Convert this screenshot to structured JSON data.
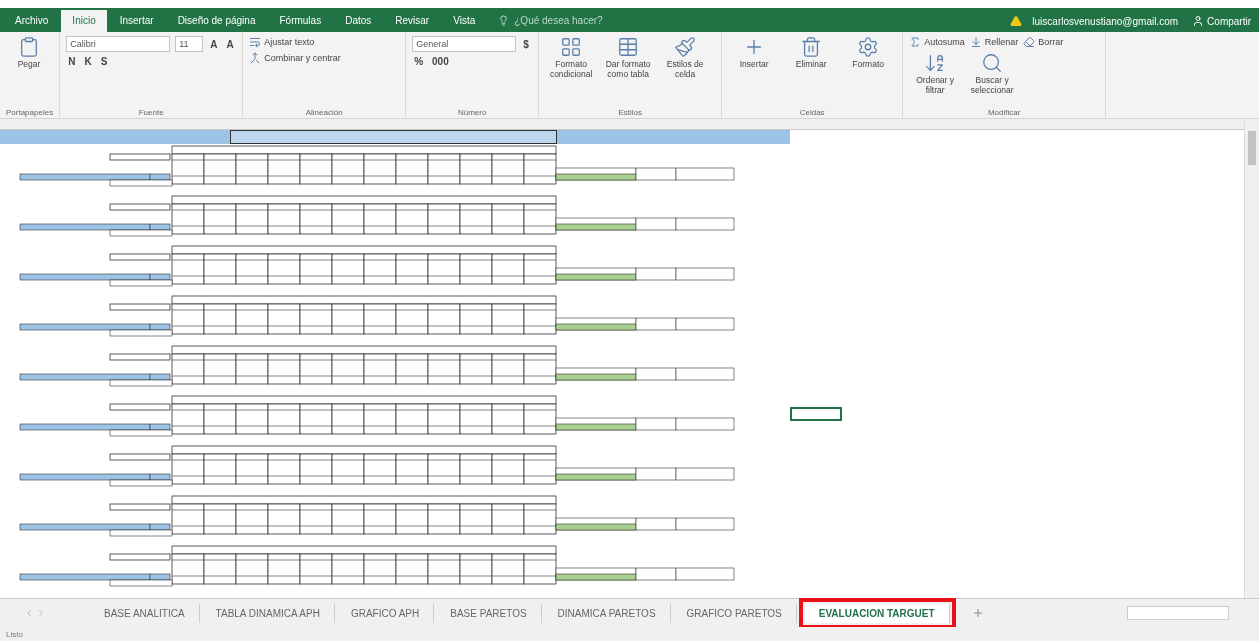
{
  "menu_tabs": [
    {
      "label": "Archivo",
      "selected": false
    },
    {
      "label": "Inicio",
      "selected": true
    },
    {
      "label": "Insertar",
      "selected": false
    },
    {
      "label": "Diseño de página",
      "selected": false
    },
    {
      "label": "Fórmulas",
      "selected": false
    },
    {
      "label": "Datos",
      "selected": false
    },
    {
      "label": "Revisar",
      "selected": false
    },
    {
      "label": "Vista",
      "selected": false
    }
  ],
  "tell_me": {
    "placeholder": "¿Qué desea hacer?"
  },
  "account": "luiscarlosvenustiano@gmail.com",
  "share": "Compartir",
  "ribbon": {
    "groups": [
      {
        "label": "Portapapeles",
        "items": [
          {
            "kind": "large",
            "label": "Pegar"
          }
        ]
      },
      {
        "label": "Fuente",
        "items": [
          {
            "kind": "field",
            "value": "Calibri",
            "wide": true
          },
          {
            "kind": "field",
            "value": "11",
            "wide": false
          },
          {
            "kind": "glyph",
            "label": "A"
          },
          {
            "kind": "glyph",
            "label": "A"
          },
          {
            "kind": "glyph",
            "label": "N"
          },
          {
            "kind": "glyph",
            "label": "K"
          },
          {
            "kind": "glyph",
            "label": "S"
          }
        ]
      },
      {
        "label": "Alineación",
        "items": [
          {
            "kind": "small",
            "label": "Ajustar texto"
          },
          {
            "kind": "small",
            "label": "Combinar y centrar"
          }
        ]
      },
      {
        "label": "Número",
        "items": [
          {
            "kind": "field",
            "value": "General",
            "wide": true
          },
          {
            "kind": "glyph",
            "label": "$"
          },
          {
            "kind": "glyph",
            "label": "%"
          },
          {
            "kind": "glyph",
            "label": "000"
          }
        ]
      },
      {
        "label": "Estilos",
        "items": [
          {
            "kind": "large",
            "label": "Formato condicional"
          },
          {
            "kind": "large",
            "label": "Dar formato como tabla"
          },
          {
            "kind": "large",
            "label": "Estilos de celda"
          }
        ]
      },
      {
        "label": "Celdas",
        "items": [
          {
            "kind": "large",
            "label": "Insertar"
          },
          {
            "kind": "large",
            "label": "Eliminar"
          },
          {
            "kind": "large",
            "label": "Formato"
          }
        ]
      },
      {
        "label": "Modificar",
        "items": [
          {
            "kind": "small",
            "label": "Autosuma"
          },
          {
            "kind": "small",
            "label": "Rellenar"
          },
          {
            "kind": "small",
            "label": "Borrar"
          },
          {
            "kind": "large",
            "label": "Ordenar y filtrar"
          },
          {
            "kind": "large",
            "label": "Buscar y seleccionar"
          }
        ]
      }
    ]
  },
  "sheet": {
    "blocks": [
      {
        "kind": "evaluation"
      },
      {
        "kind": "evaluation"
      },
      {
        "kind": "evaluation"
      },
      {
        "kind": "evaluation"
      },
      {
        "kind": "evaluation"
      },
      {
        "kind": "evaluation"
      },
      {
        "kind": "evaluation"
      },
      {
        "kind": "evaluation"
      },
      {
        "kind": "evaluation"
      }
    ]
  },
  "sheet_tabs": [
    {
      "label": "BASE ANALITICA",
      "selected": false,
      "highlighted": false
    },
    {
      "label": "TABLA DINAMICA APH",
      "selected": false,
      "highlighted": false
    },
    {
      "label": "GRAFICO APH",
      "selected": false,
      "highlighted": false
    },
    {
      "label": "BASE PARETOS",
      "selected": false,
      "highlighted": false
    },
    {
      "label": "DINAMICA PARETOS",
      "selected": false,
      "highlighted": false
    },
    {
      "label": "GRAFICO PARETOS",
      "selected": false,
      "highlighted": false
    },
    {
      "label": "EVALUACION TARGUET",
      "selected": true,
      "highlighted": true
    }
  ],
  "status": "Listo"
}
